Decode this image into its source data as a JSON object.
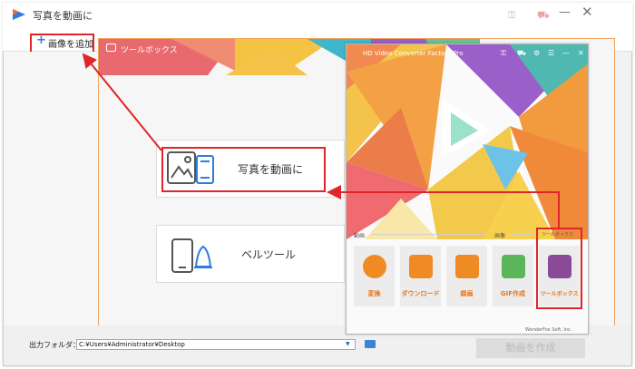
{
  "window": {
    "title": "写真を動画に",
    "minimize": "—",
    "close": "✕"
  },
  "toolbar": {
    "add_plus": "+",
    "add_label": "画像を追加"
  },
  "toolbox": {
    "title": "ツールボックス",
    "cards": [
      {
        "label": "写真を動画に"
      },
      {
        "label": "ベルツール"
      }
    ]
  },
  "output": {
    "label": "出力フォルダ：",
    "path": "C:¥Users¥Administrator¥Desktop"
  },
  "create_button": "動画を作成",
  "converter": {
    "title": "HD Video Converter Factory Pro",
    "minimize": "—",
    "close": "✕",
    "sections": {
      "video": "動画",
      "image": "画像",
      "toolbox": "ツールボックス"
    },
    "tiles": [
      {
        "label": "変換"
      },
      {
        "label": "ダウンロード"
      },
      {
        "label": "録画"
      },
      {
        "label": "GIF作成"
      },
      {
        "label": "ツールボックス"
      }
    ],
    "footer": "WonderFox Soft, Inc."
  },
  "colors": {
    "highlight_red": "#e0262a",
    "accent_orange": "#f08a24",
    "toolbox_purple": "#8a4a9a"
  }
}
